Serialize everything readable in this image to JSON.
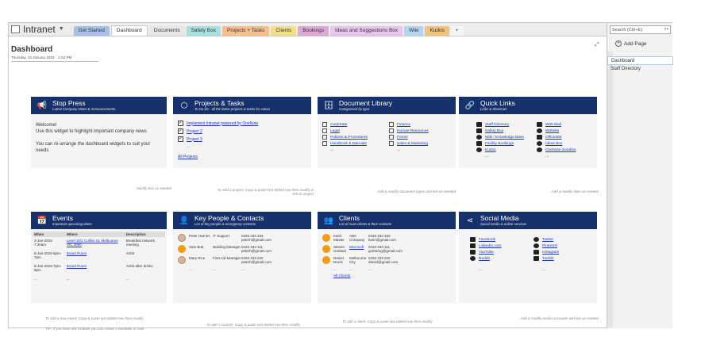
{
  "notebook": {
    "name": "Intranet"
  },
  "tabs": [
    {
      "label": "Get Started",
      "color": "#a6c1e8",
      "active": false
    },
    {
      "label": "Dashboard",
      "color": "#ffffff",
      "active": true
    },
    {
      "label": "Documents",
      "color": "#e8e8e8",
      "active": false
    },
    {
      "label": "Safety Box",
      "color": "#a8e0e0",
      "active": false
    },
    {
      "label": "Projects + Tasks",
      "color": "#f6c08e",
      "active": false
    },
    {
      "label": "Clients",
      "color": "#f5e08a",
      "active": false
    },
    {
      "label": "Bookings",
      "color": "#e0a8d8",
      "active": false
    },
    {
      "label": "Ideas and Suggestions Box",
      "color": "#e9c4ee",
      "active": false
    },
    {
      "label": "Wiki",
      "color": "#b4d4f2",
      "active": false
    },
    {
      "label": "Kudos",
      "color": "#f0c27a",
      "active": false
    },
    {
      "label": "+",
      "color": "#f5f5f5",
      "active": false
    }
  ],
  "search": {
    "placeholder": "Search (Ctrl+E)"
  },
  "sidebar": {
    "add_page": "Add Page",
    "pages": [
      {
        "label": "Dashboard",
        "selected": true
      },
      {
        "label": "Staff Directory",
        "selected": false
      }
    ]
  },
  "page": {
    "title": "Dashboard",
    "date": "Thursday, 10 January 2019",
    "time": "1:52 PM"
  },
  "stop_press": {
    "title": "Stop Press",
    "subtitle": "Latest Company News & Announcements",
    "line1": "Welcome!",
    "line2": "Use this widget to highlight important company news",
    "line3": "You can re-arrange the dashboard widgets to suit your needs",
    "note": "Modify text as needed"
  },
  "projects": {
    "title": "Projects & Tasks",
    "subtitle": "To Do list - all the latest projects & tasks for action",
    "items": [
      "Implement Intranet powered by OneNote",
      "Project 2",
      "Project 3"
    ],
    "more": "...",
    "all_link": "All Projects",
    "note": "To add a project: Copy & paste last dotted row then modify & link to project"
  },
  "documents": {
    "title": "Document Library",
    "subtitle": "Categorised by type",
    "items": [
      "Corporate",
      "Finance",
      "Legal",
      "Human Resources",
      "Policies & Procedures",
      "Forms",
      "Handbook & Manuals",
      "Sales & Marketing"
    ],
    "more1": "...",
    "more2": "...",
    "note": "Add & modify document types and link as needed"
  },
  "quicklinks": {
    "title": "Quick Links",
    "subtitle": "Links & Shortcuts",
    "items": [
      "Staff Directory",
      "Web Mail",
      "Safety Box",
      "Website",
      "Wiki / Knowledge Base",
      "Office365",
      "Facility Bookings",
      "Ideas Box",
      "Kudos",
      "OneNote Goodies"
    ],
    "more1": "...",
    "more2": "...",
    "note": "Add & modify links as needed"
  },
  "events": {
    "title": "Events",
    "subtitle": "Important upcoming dates",
    "headers": [
      "When",
      "Where",
      "Description"
    ],
    "rows": [
      {
        "when": "3-Jan-2019 7:30am",
        "where": "Level 10/1 Collins St, Melbourne VIC 3000",
        "desc": "Breakfast network meeting"
      },
      {
        "when": "8-Jan-2019 6pm-7pm",
        "where": "Board Room",
        "desc": "AGM"
      },
      {
        "when": "8-Jan-2019 7pm-8pm",
        "where": "Board Room",
        "desc": "AGM after drinks"
      },
      {
        "when": "...",
        "where": "...",
        "desc": "..."
      }
    ],
    "note1": "To add a new event: Copy & paste last dotted row then modify",
    "note2": "TIP: If you have MS Outlook you can create a reminder or task"
  },
  "people": {
    "title": "Key People & Contacts",
    "subtitle": "List of key people & emergency contacts",
    "rows": [
      {
        "name": "Peter Harries",
        "role": "IT Support",
        "contact": "0433 333 333 peterh@gmail.com"
      },
      {
        "name": "Sam Bott",
        "role": "Building Manager",
        "contact": "0433 333 111 peterh@gmail.com"
      },
      {
        "name": "Mary Rice",
        "role": "First Aid Manager",
        "contact": "0433 333 222 peterh@gmail.com"
      },
      {
        "name": "...",
        "role": "...",
        "contact": "..."
      }
    ],
    "note": "To add a contact: Copy & paste last dotted row then modify"
  },
  "clients": {
    "title": "Clients",
    "subtitle": "List of main clients & their contacts",
    "rows": [
      {
        "name": "Karin Master",
        "company": "ABC Company",
        "contact": "0433 333 333 karin@gmail.com"
      },
      {
        "name": "Steven Graham",
        "company": "Microsoft",
        "contact": "0433 333 111 grahamg@gmail.com"
      },
      {
        "name": "Daniel Druck",
        "company": "Melbourne City",
        "contact": "0433 333 222 daniel@gmail.com"
      },
      {
        "name": "...",
        "company": "...",
        "contact": "..."
      }
    ],
    "all_link": "All Clients",
    "note": "To add a client: Copy & paste last dotted row then modify"
  },
  "social": {
    "title": "Social Media",
    "subtitle": "Social media & online services",
    "items": [
      "Facebook",
      "Twitter",
      "LinkedIn.com",
      "Pinterest",
      "YouTube",
      "Instagram",
      "Reddit",
      "Tumblr"
    ],
    "more1": "...",
    "more2": "...",
    "note": "Add & modify media accounts and link as needed"
  }
}
